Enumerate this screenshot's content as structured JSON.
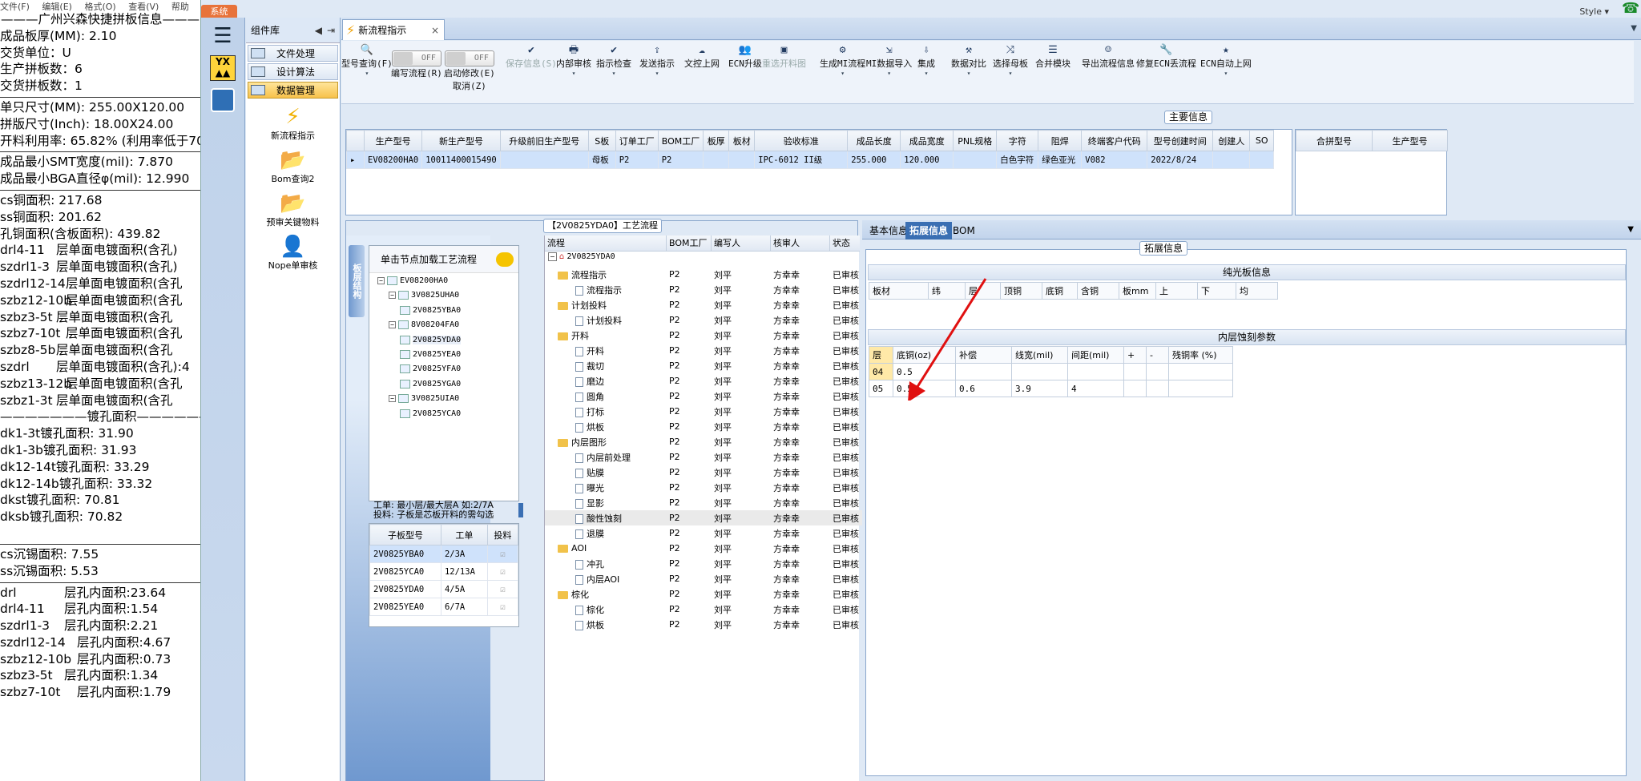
{
  "left_menu": [
    "文件(F)",
    "编辑(E)",
    "格式(O)",
    "查看(V)",
    "帮助"
  ],
  "info": {
    "company_title": "广州兴森快捷拼板信息",
    "lines_a": [
      "成品板厚(MM): 2.10",
      "交货单位：U",
      "生产拼板数：6",
      "交货拼板数：1"
    ],
    "lines_b": [
      "单只尺寸(MM): 255.00X120.00",
      "拼版尺寸(Inch): 18.00X24.00",
      "开料利用率: 65.82% (利用率低于70"
    ],
    "lines_c": [
      "成品最小SMT宽度(mil): 7.870",
      "成品最小BGA直径φ(mil):   12.990"
    ],
    "lines_d": [
      "cs铜面积: 217.68",
      "ss铜面积: 201.62",
      "孔铜面积(含板面积): 439.82"
    ],
    "plating": [
      {
        "name": "drl4-11",
        "text": "层单面电镀面积(含孔)"
      },
      {
        "name": "szdrl1-3",
        "text": "层单面电镀面积(含孔)"
      },
      {
        "name": "szdrl12-14",
        "text": "层单面电镀面积(含孔"
      },
      {
        "name": "szbz12-10b",
        "text": "层单面电镀面积(含孔"
      },
      {
        "name": "szbz3-5t",
        "text": "层单面电镀面积(含孔"
      },
      {
        "name": "szbz7-10t",
        "text": "层单面电镀面积(含孔"
      },
      {
        "name": "szbz8-5b",
        "text": "层单面电镀面积(含孔"
      },
      {
        "name": "szdrl",
        "text": "层单面电镀面积(含孔):4"
      },
      {
        "name": "szbz13-12b",
        "text": "层单面电镀面积(含孔"
      },
      {
        "name": "szbz1-3t",
        "text": "层单面电镀面积(含孔"
      }
    ],
    "hole_area_title": "镀孔面积",
    "hole_lines": [
      "dk1-3t镀孔面积: 31.90",
      "dk1-3b镀孔面积: 31.93",
      "dk12-14t镀孔面积: 33.29",
      "dk12-14b镀孔面积: 33.32",
      "dkst镀孔面积: 70.81",
      "dksb镀孔面积: 70.82"
    ],
    "tin_lines": [
      "cs沉锡面积: 7.55",
      "ss沉锡面积: 5.53"
    ],
    "inner_hole": [
      {
        "name": "drl",
        "text": "层孔内面积:23.64"
      },
      {
        "name": "drl4-11",
        "text": "层孔内面积:1.54"
      },
      {
        "name": "szdrl1-3",
        "text": "层孔内面积:2.21"
      },
      {
        "name": "szdrl12-14",
        "text": "层孔内面积:4.67"
      },
      {
        "name": "szbz12-10b",
        "text": "层孔内面积:0.73"
      },
      {
        "name": "szbz3-5t",
        "text": "层孔内面积:1.34"
      },
      {
        "name": "szbz7-10t",
        "text": "层孔内面积:1.79"
      }
    ]
  },
  "app": {
    "system_label": "系统",
    "style_label": "Style",
    "component_library": {
      "title": "组件库",
      "categories": [
        "文件处理",
        "设计算法",
        "数据管理"
      ],
      "active_category": "数据管理"
    },
    "components": [
      "新流程指示",
      "Bom查询2",
      "预审关键物料",
      "Nope单审核"
    ],
    "tab_title": "新流程指示",
    "ribbon": {
      "items": [
        {
          "label": "型号查询(F)",
          "icon": "search-icon"
        },
        {
          "label": "编写流程(R)",
          "toggle": "OFF"
        },
        {
          "label": "启动修改(E)",
          "toggle": "OFF",
          "sub": "取消(Z)"
        },
        {
          "label": "保存信息(S)",
          "icon": "check-icon"
        },
        {
          "label": "内部审核",
          "icon": "print-icon"
        },
        {
          "label": "指示检查",
          "icon": "check-icon"
        },
        {
          "label": "发送指示",
          "icon": "upload-icon"
        },
        {
          "label": "文控上网",
          "icon": "cloud-icon"
        },
        {
          "label": "ECN升级",
          "icon": "people-icon"
        },
        {
          "label": "重选开料图",
          "icon": "image-icon"
        },
        {
          "label": "生成MI流程",
          "icon": "gear-icon"
        },
        {
          "label": "MI数据导入",
          "icon": "import-icon"
        },
        {
          "label": "集成",
          "icon": "download-icon"
        },
        {
          "label": "数据对比",
          "icon": "compare-icon"
        },
        {
          "label": "选择母板",
          "icon": "shuffle-icon"
        },
        {
          "label": "合并模块",
          "icon": "list-icon"
        },
        {
          "label": "导出流程信息",
          "icon": "smile-icon"
        },
        {
          "label": "修复ECN丢流程",
          "icon": "wrench-icon"
        },
        {
          "label": "ECN自动上网",
          "icon": "star-icon"
        }
      ]
    },
    "main_info_label": "主要信息",
    "main_table": {
      "columns": [
        "生产型号",
        "新生产型号",
        "升级前旧生产型号",
        "S板",
        "订单工厂",
        "BOM工厂",
        "板厚",
        "板材",
        "验收标准",
        "成品长度",
        "成品宽度",
        "PNL规格",
        "字符",
        "阻焊",
        "终端客户代码",
        "型号创建时间",
        "创建人",
        "SO"
      ],
      "rows": [
        [
          "EV08200HA0",
          "10011400015490",
          "",
          "母板",
          "P2",
          "P2",
          "",
          "",
          "IPC-6012 II级",
          "255.000",
          "120.000",
          "",
          "白色字符",
          "绿色亚光",
          "V082",
          "2022/8/24",
          "",
          ""
        ]
      ]
    },
    "right_table_columns": [
      "合拼型号",
      "生产型号"
    ],
    "flow_title": "【2V0825YDA0】工艺流程",
    "pcb_nav_label": "板层结构",
    "tree": {
      "header": "单击节点加载工艺流程",
      "nodes": [
        {
          "label": "EV08200HA0",
          "level": 0
        },
        {
          "label": "3V0825UHA0",
          "level": 1
        },
        {
          "label": "2V0825YBA0",
          "level": 2
        },
        {
          "label": "8V08204FA0",
          "level": 1
        },
        {
          "label": "2V0825YDA0",
          "level": 2
        },
        {
          "label": "2V0825YEA0",
          "level": 2
        },
        {
          "label": "2V0825YFA0",
          "level": 2
        },
        {
          "label": "2V0825YGA0",
          "level": 2
        },
        {
          "label": "3V0825UIA0",
          "level": 1
        },
        {
          "label": "2V0825YCA0",
          "level": 2
        }
      ]
    },
    "work_note": [
      "工单: 最小层/最大层A 如:2/7A",
      "投料: 子板是芯板开料的需勾选"
    ],
    "sub_table": {
      "columns": [
        "子板型号",
        "工单",
        "投料"
      ],
      "rows": [
        [
          "2V0825YBA0",
          "2/3A"
        ],
        [
          "2V0825YCA0",
          "12/13A"
        ],
        [
          "2V0825YDA0",
          "4/5A"
        ],
        [
          "2V0825YEA0",
          "6/7A"
        ]
      ]
    },
    "flow": {
      "columns": [
        "流程",
        "BOM工厂",
        "编写人",
        "核审人",
        "状态"
      ],
      "root": "2V0825YDA0",
      "rows": [
        {
          "name": "流程指示",
          "folder": true
        },
        {
          "name": "流程指示",
          "folder": false
        },
        {
          "name": "计划投料",
          "folder": true
        },
        {
          "name": "计划投料",
          "folder": false
        },
        {
          "name": "开料",
          "folder": true
        },
        {
          "name": "开料",
          "folder": false
        },
        {
          "name": "裁切",
          "folder": false
        },
        {
          "name": "磨边",
          "folder": false
        },
        {
          "name": "圆角",
          "folder": false
        },
        {
          "name": "打标",
          "folder": false
        },
        {
          "name": "烘板",
          "folder": false
        },
        {
          "name": "内层图形",
          "folder": true
        },
        {
          "name": "内层前处理",
          "folder": false
        },
        {
          "name": "贴膜",
          "folder": false
        },
        {
          "name": "曝光",
          "folder": false
        },
        {
          "name": "显影",
          "folder": false
        },
        {
          "name": "酸性蚀刻",
          "folder": false,
          "highlight": true
        },
        {
          "name": "退膜",
          "folder": false
        },
        {
          "name": "AOI",
          "folder": true
        },
        {
          "name": "冲孔",
          "folder": false
        },
        {
          "name": "内层AOI",
          "folder": false
        },
        {
          "name": "棕化",
          "folder": true
        },
        {
          "name": "棕化",
          "folder": false
        },
        {
          "name": "烘板",
          "folder": false
        }
      ],
      "factory": "P2",
      "writer": "刘平",
      "reviewer": "方幸幸",
      "status": "已审核"
    },
    "right_tabs": [
      "基本信息",
      "拓展信息",
      "BOM"
    ],
    "active_right_tab": "拓展信息",
    "ext_label": "拓展信息",
    "pure_board_title": "纯光板信息",
    "pure_board_columns": [
      "板材",
      "纬",
      "层",
      "顶铜",
      "底铜",
      "含铜",
      "板mm",
      "上",
      "下",
      "均"
    ],
    "inner_etch_title": "内层蚀刻参数",
    "inner_etch": {
      "columns": [
        "层",
        "底铜(oz)",
        "补偿",
        "线宽(mil)",
        "间距(mil)",
        "+",
        "-",
        "残铜率 (%)"
      ],
      "rows": [
        [
          "04",
          "0.5",
          "",
          "",
          "",
          "",
          "",
          ""
        ],
        [
          "05",
          "0.5",
          "0.6",
          "3.9",
          "4",
          "",
          "",
          ""
        ]
      ]
    },
    "accent_color": "#3a6fb3"
  }
}
